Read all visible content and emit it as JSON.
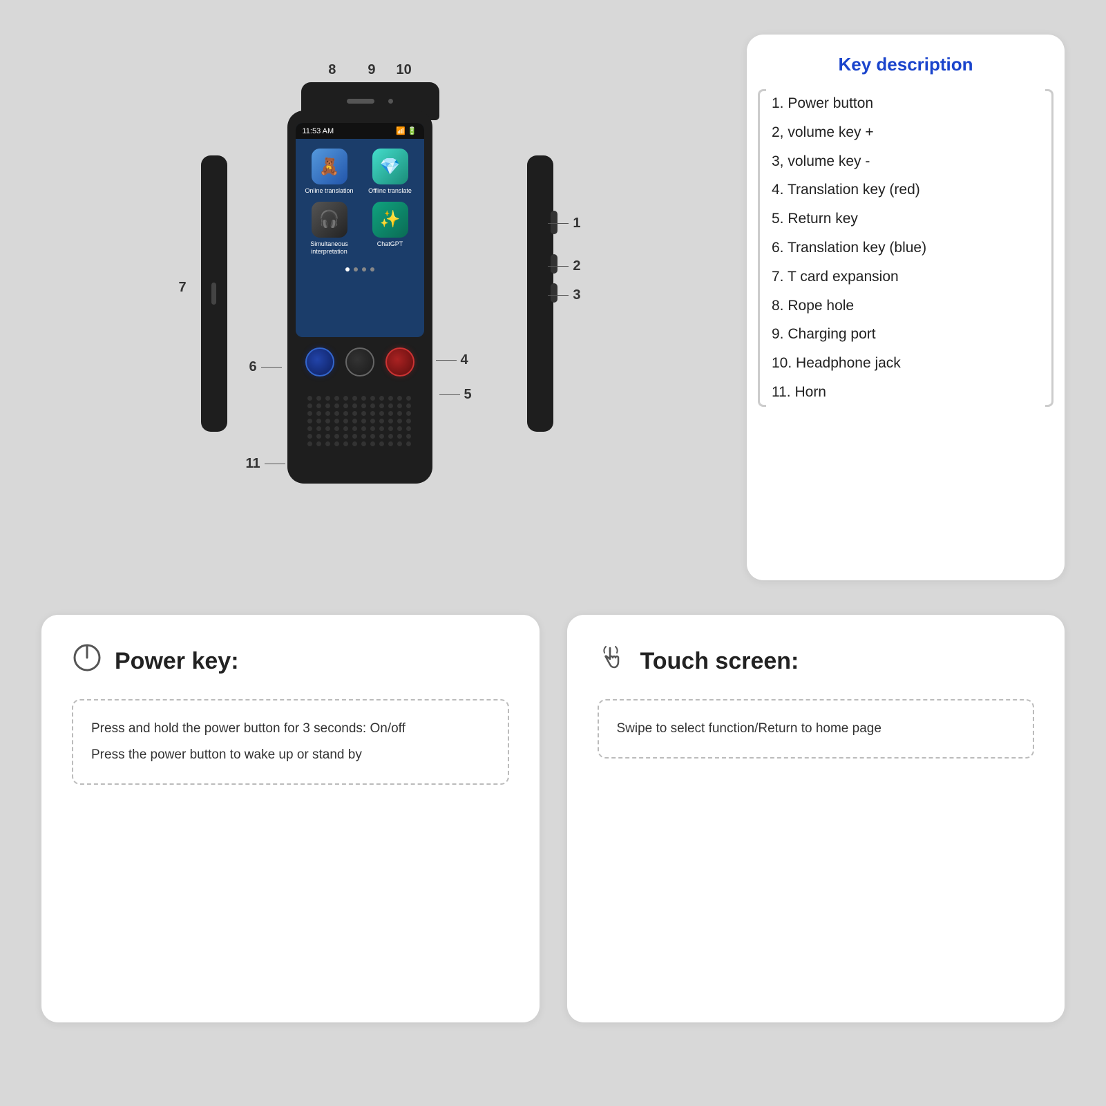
{
  "page": {
    "background": "#d8d8d8"
  },
  "top_numbers": {
    "n8": "8",
    "n9": "9",
    "n10": "10"
  },
  "side_numbers": {
    "n7": "7",
    "n1": "1",
    "n2": "2",
    "n3": "3",
    "n4": "4",
    "n5": "5",
    "n6": "6",
    "n11": "11"
  },
  "screen": {
    "time": "11:53 AM",
    "icons": [
      {
        "label": "Online translation",
        "emoji": "🧸"
      },
      {
        "label": "Offline translate",
        "emoji": "💎"
      },
      {
        "label": "Simultaneous interpretation",
        "emoji": "🎧"
      },
      {
        "label": "ChatGPT",
        "emoji": "✨"
      }
    ]
  },
  "key_description": {
    "title": "Key description",
    "items": [
      "1. Power button",
      "2, volume key +",
      "3, volume key -",
      "4. Translation key (red)",
      "5. Return key",
      "6. Translation key (blue)",
      "7. T card expansion",
      "8. Rope hole",
      "9. Charging port",
      "10. Headphone jack",
      "11. Horn"
    ]
  },
  "power_key_box": {
    "title": "Power key:",
    "lines": [
      "Press and hold the power button for 3 seconds: On/off",
      "Press the power button to wake up or stand by"
    ]
  },
  "touch_screen_box": {
    "title": "Touch screen:",
    "lines": [
      "Swipe to select function/Return to home page"
    ]
  }
}
